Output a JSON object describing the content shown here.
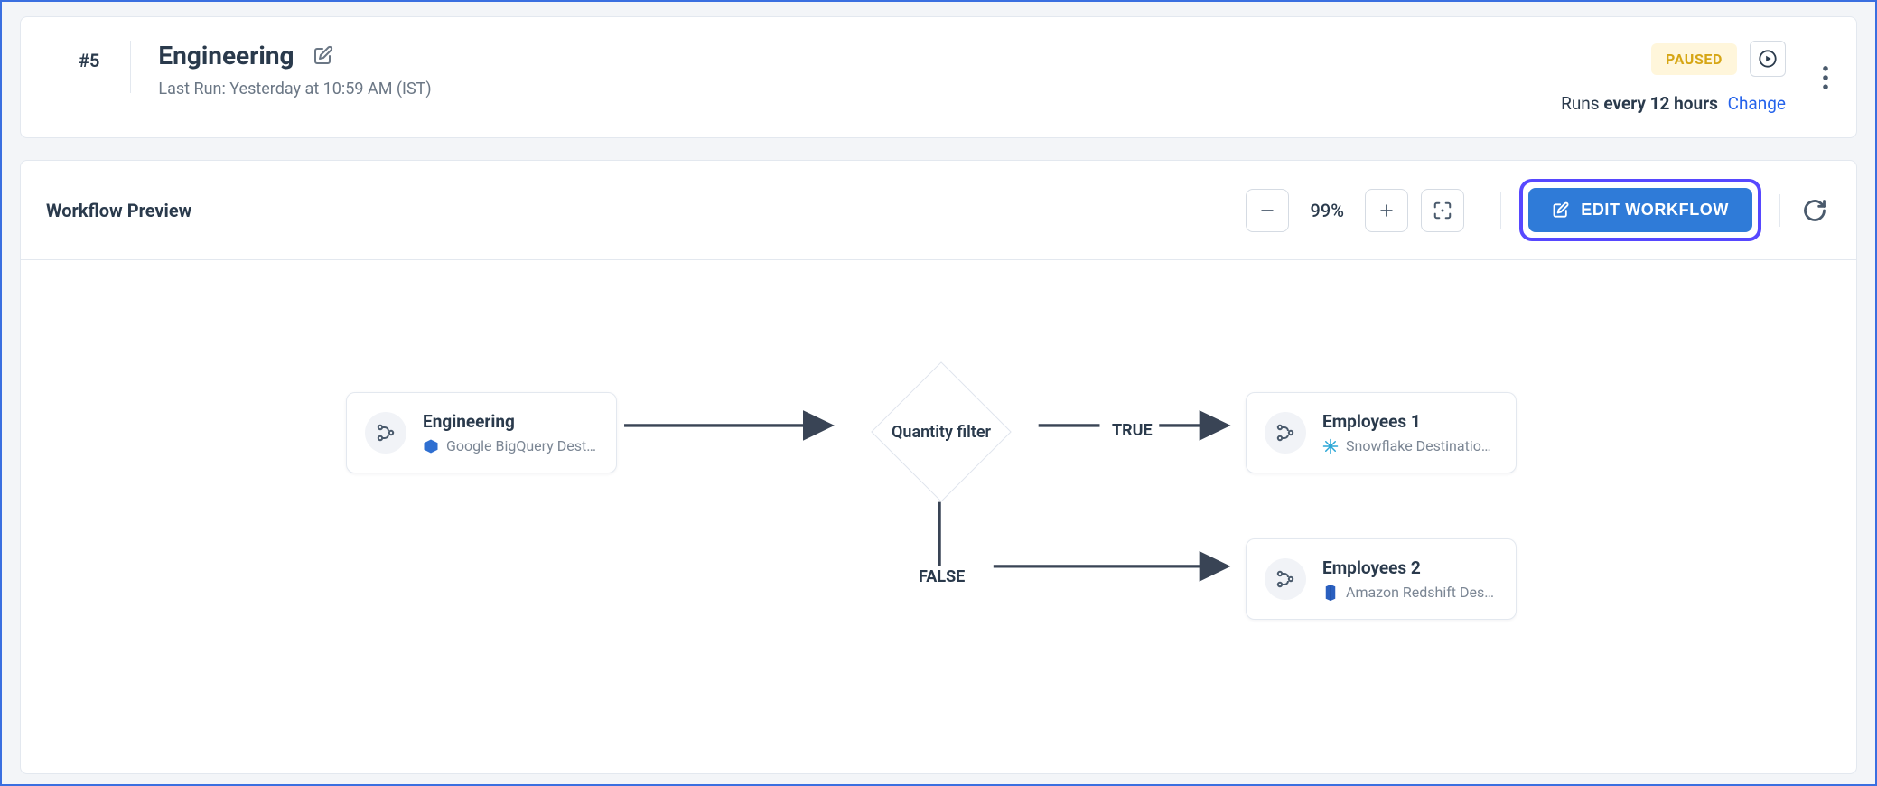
{
  "header": {
    "id_number": "#5",
    "title": "Engineering",
    "last_run_label": "Last Run: Yesterday at 10:59 AM (IST)",
    "status_badge": "PAUSED",
    "schedule_prefix": "Runs ",
    "schedule_bold": "every 12 hours",
    "schedule_change": "Change"
  },
  "toolbar": {
    "preview_title": "Workflow Preview",
    "zoom_pct": "99%",
    "edit_label": "EDIT WORKFLOW"
  },
  "canvas": {
    "source_node": {
      "title": "Engineering",
      "subtitle": "Google BigQuery Desti..."
    },
    "filter_label": "Quantity filter",
    "edge_true": "TRUE",
    "edge_false": "FALSE",
    "true_node": {
      "title": "Employees 1",
      "subtitle": "Snowflake Destination..."
    },
    "false_node": {
      "title": "Employees 2",
      "subtitle": "Amazon Redshift Desti..."
    }
  }
}
